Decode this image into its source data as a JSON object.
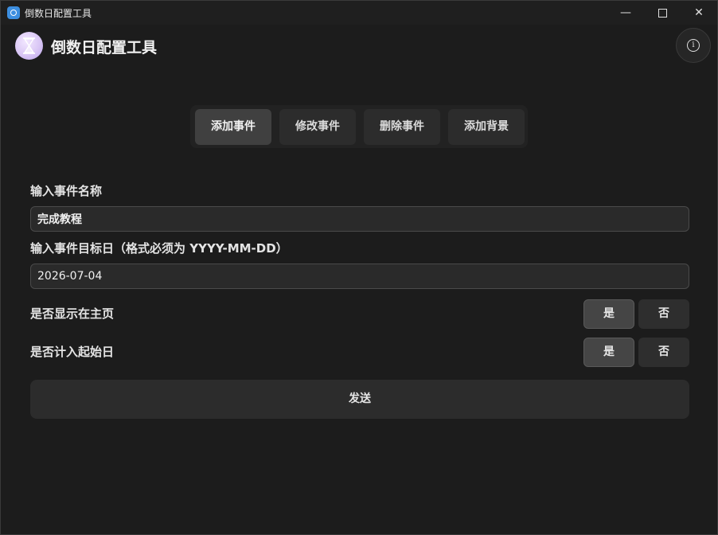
{
  "window": {
    "title": "倒数日配置工具",
    "minimize_glyph": "—",
    "close_glyph": "✕"
  },
  "header": {
    "app_title": "倒数日配置工具",
    "logo_icon": "hourglass-icon",
    "info_icon": "info-icon",
    "info_glyph": "i"
  },
  "tabs": [
    {
      "label": "添加事件",
      "active": true
    },
    {
      "label": "修改事件",
      "active": false
    },
    {
      "label": "删除事件",
      "active": false
    },
    {
      "label": "添加背景",
      "active": false
    }
  ],
  "form": {
    "name_label": "输入事件名称",
    "name_value": "完成教程",
    "date_label": "输入事件目标日（格式必须为 YYYY-MM-DD）",
    "date_value": "2026-07-04",
    "show_home_label": "是否显示在主页",
    "show_home_options": {
      "yes": "是",
      "no": "否",
      "selected": "yes"
    },
    "count_start_label": "是否计入起始日",
    "count_start_options": {
      "yes": "是",
      "no": "否",
      "selected": "yes"
    },
    "submit_label": "发送"
  },
  "colors": {
    "background": "#1c1c1c",
    "surface": "#2c2c2c",
    "active": "#404040",
    "text": "#e6e6e6"
  }
}
